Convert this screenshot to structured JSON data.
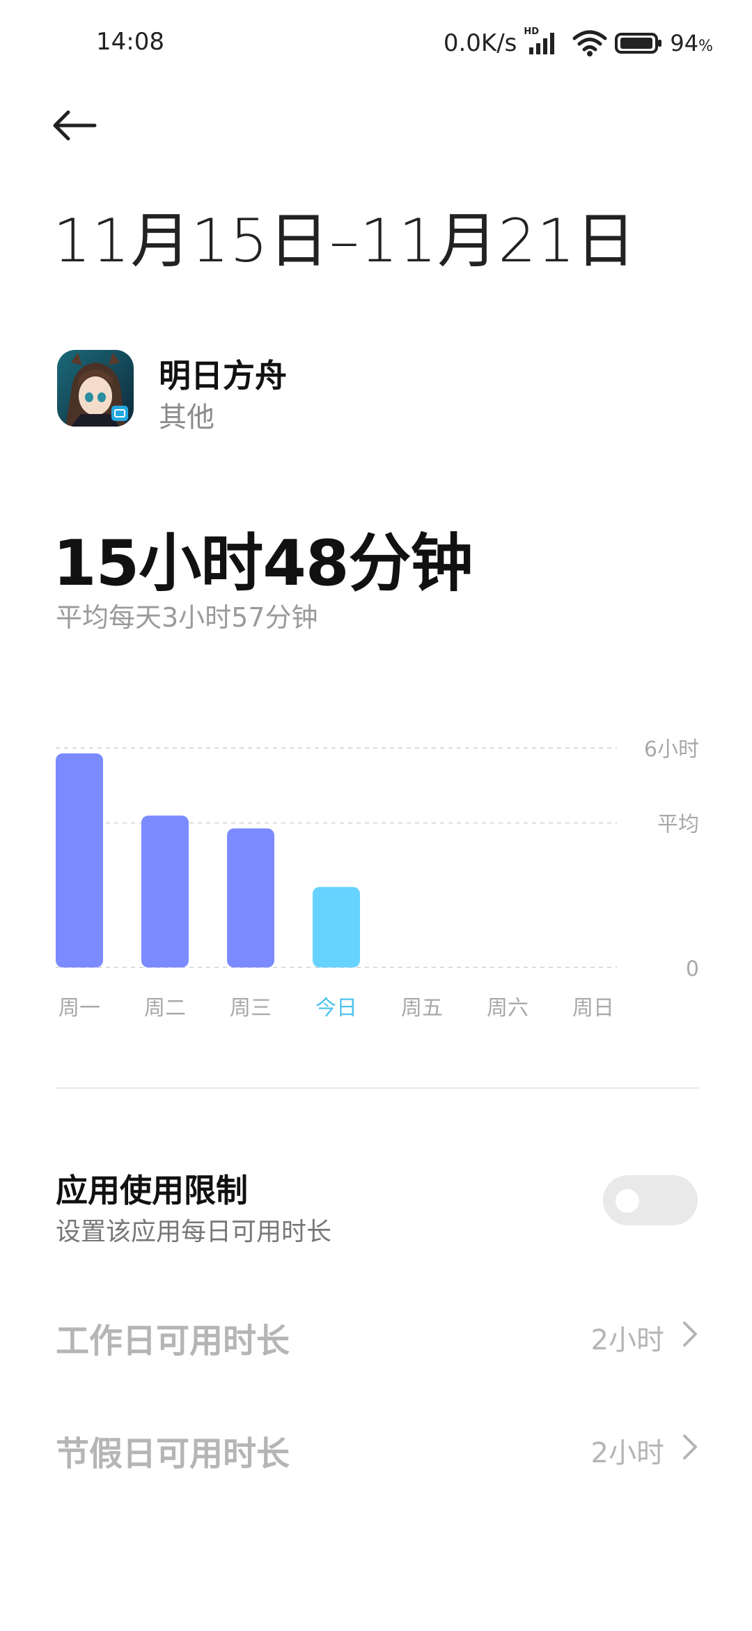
{
  "status_bar": {
    "time": "14:08",
    "net_speed": "0.0K/s",
    "hd_label": "HD",
    "battery_pct": "94",
    "battery_unit": "%"
  },
  "header": {
    "date_range": "11月15日–11月21日"
  },
  "app": {
    "name": "明日方舟",
    "category": "其他",
    "icon": "arknights-app-icon"
  },
  "usage": {
    "total": "15小时48分钟",
    "average": "平均每天3小时57分钟"
  },
  "chart_data": {
    "type": "bar",
    "categories": [
      "周一",
      "周二",
      "周三",
      "今日",
      "周五",
      "周六",
      "周日"
    ],
    "values": [
      5.85,
      4.15,
      3.8,
      2.2,
      0,
      0,
      0
    ],
    "value_unit": "小时",
    "highlight_index": 3,
    "y_reference_lines": [
      {
        "label": "6小时",
        "value": 6
      },
      {
        "label": "平均",
        "value": 3.95
      },
      {
        "label": "0",
        "value": 0
      }
    ],
    "ylim": [
      0,
      6
    ],
    "grid": true,
    "colors": {
      "bar": "#7b8bff",
      "today": "#66d2ff",
      "today_label": "#4fc3ec",
      "label": "#a8a8a8"
    }
  },
  "limit": {
    "title": "应用使用限制",
    "subtitle": "设置该应用每日可用时长",
    "enabled": false
  },
  "settings": [
    {
      "label": "工作日可用时长",
      "value": "2小时"
    },
    {
      "label": "节假日可用时长",
      "value": "2小时"
    }
  ]
}
